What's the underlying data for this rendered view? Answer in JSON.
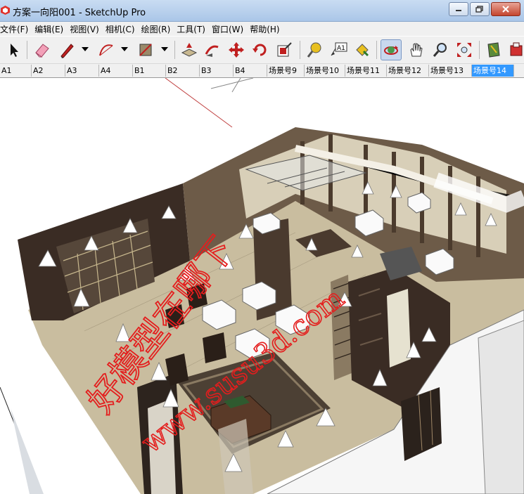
{
  "window": {
    "title": "方案一向阳001 - SketchUp Pro",
    "icon": "sketchup-app-icon"
  },
  "menu": [
    "文件(F)",
    "编辑(E)",
    "视图(V)",
    "相机(C)",
    "绘图(R)",
    "工具(T)",
    "窗口(W)",
    "帮助(H)"
  ],
  "toolbar": [
    {
      "name": "select-icon"
    },
    {
      "name": "eraser-icon"
    },
    {
      "name": "pencil-line-icon"
    },
    {
      "name": "arc-icon"
    },
    {
      "name": "rectangle-icon"
    },
    {
      "name": "push-pull-icon"
    },
    {
      "name": "follow-me-icon"
    },
    {
      "name": "move-icon"
    },
    {
      "name": "rotate-icon"
    },
    {
      "name": "offset-icon"
    },
    {
      "name": "tape-measure-icon"
    },
    {
      "name": "text-icon"
    },
    {
      "name": "paint-bucket-icon"
    },
    {
      "name": "orbit-icon"
    },
    {
      "name": "pan-icon"
    },
    {
      "name": "zoom-icon"
    },
    {
      "name": "zoom-extents-icon"
    },
    {
      "name": "warehouse-icon"
    },
    {
      "name": "extension-icon"
    }
  ],
  "text_tool_label": "A1",
  "scenes": {
    "tabs": [
      "A1",
      "A2",
      "A3",
      "A4",
      "B1",
      "B2",
      "B3",
      "B4",
      "场景号9",
      "场景号10",
      "场景号11",
      "场景号12",
      "场景号13",
      "场景号14"
    ],
    "active": "场景号14"
  },
  "watermark": {
    "lines": [
      "好模型在哪下",
      "www.susu3d.com"
    ],
    "color": "#e41d1d"
  },
  "colors": {
    "titlebar": "#b9d1ee",
    "scene_active": "#3399ff",
    "floor": "#c8bca0",
    "dark_wood": "#3a2a20",
    "wall_white": "#f6f6f6"
  }
}
